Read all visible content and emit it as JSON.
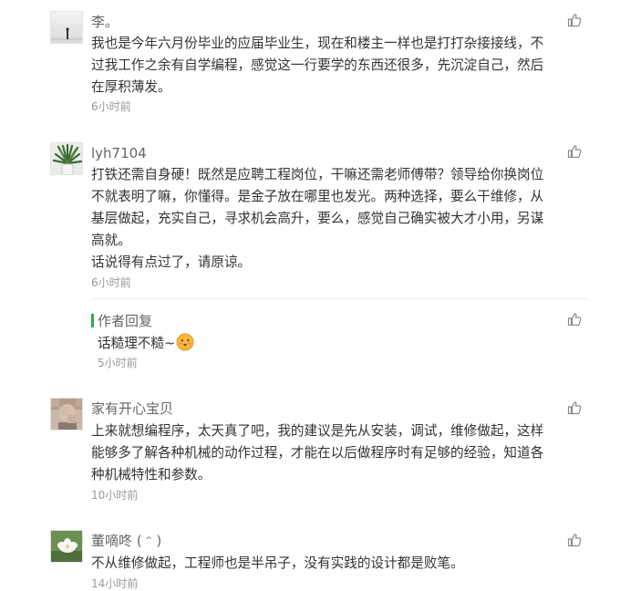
{
  "comments": [
    {
      "name": "李。",
      "lines": [
        "我也是今年六月份毕业的应届毕业生，现在和楼主一样也是打打杂接接线，不",
        "过我工作之余有自学编程，感觉这一行要学的东西还很多，先沉淀自己，然后",
        "在厚积薄发。"
      ],
      "time": "6小时前",
      "avatar": "silhouette-avatar"
    },
    {
      "name": "lyh7104",
      "lines": [
        "打铁还需自身硬！既然是应聘工程岗位，干嘛还需老师傅带？领导给你换岗位",
        "不就表明了嘛，你懂得。是金子放在哪里也发光。两种选择，要么干维修，从",
        "基层做起，充实自己，寻求机会高升，要么，感觉自己确实被大才小用，另谋",
        "高就。",
        "话说得有点过了，请原谅。"
      ],
      "time": "6小时前",
      "avatar": "plant-avatar"
    },
    {
      "name": "家有开心宝贝",
      "lines": [
        "上来就想编程序，太天真了吧，我的建议是先从安装，调试，维修做起，这样",
        "能够多了解各种机械的动作过程，才能在以后做程序时有足够的经验，知道各",
        "种机械特性和参数。"
      ],
      "time": "10小时前",
      "avatar": "blurred-portrait-avatar"
    },
    {
      "name": "董嘀咚 ( ᵔ )",
      "lines": [
        "不从维修做起，工程师也是半吊子，没有实践的设计都是败笔。"
      ],
      "time": "14小时前",
      "avatar": "lotus-avatar"
    }
  ],
  "author_reply": {
    "label": "作者回复",
    "text": "话糙理不糙~",
    "emoji": "blushing-face-emoji",
    "time": "5小时前"
  },
  "icons": {
    "like": "thumbs-up-icon"
  },
  "colors": {
    "accent_green": "#35a845",
    "meta_gray": "#999999",
    "name_gray": "#666666",
    "text": "#333333"
  }
}
